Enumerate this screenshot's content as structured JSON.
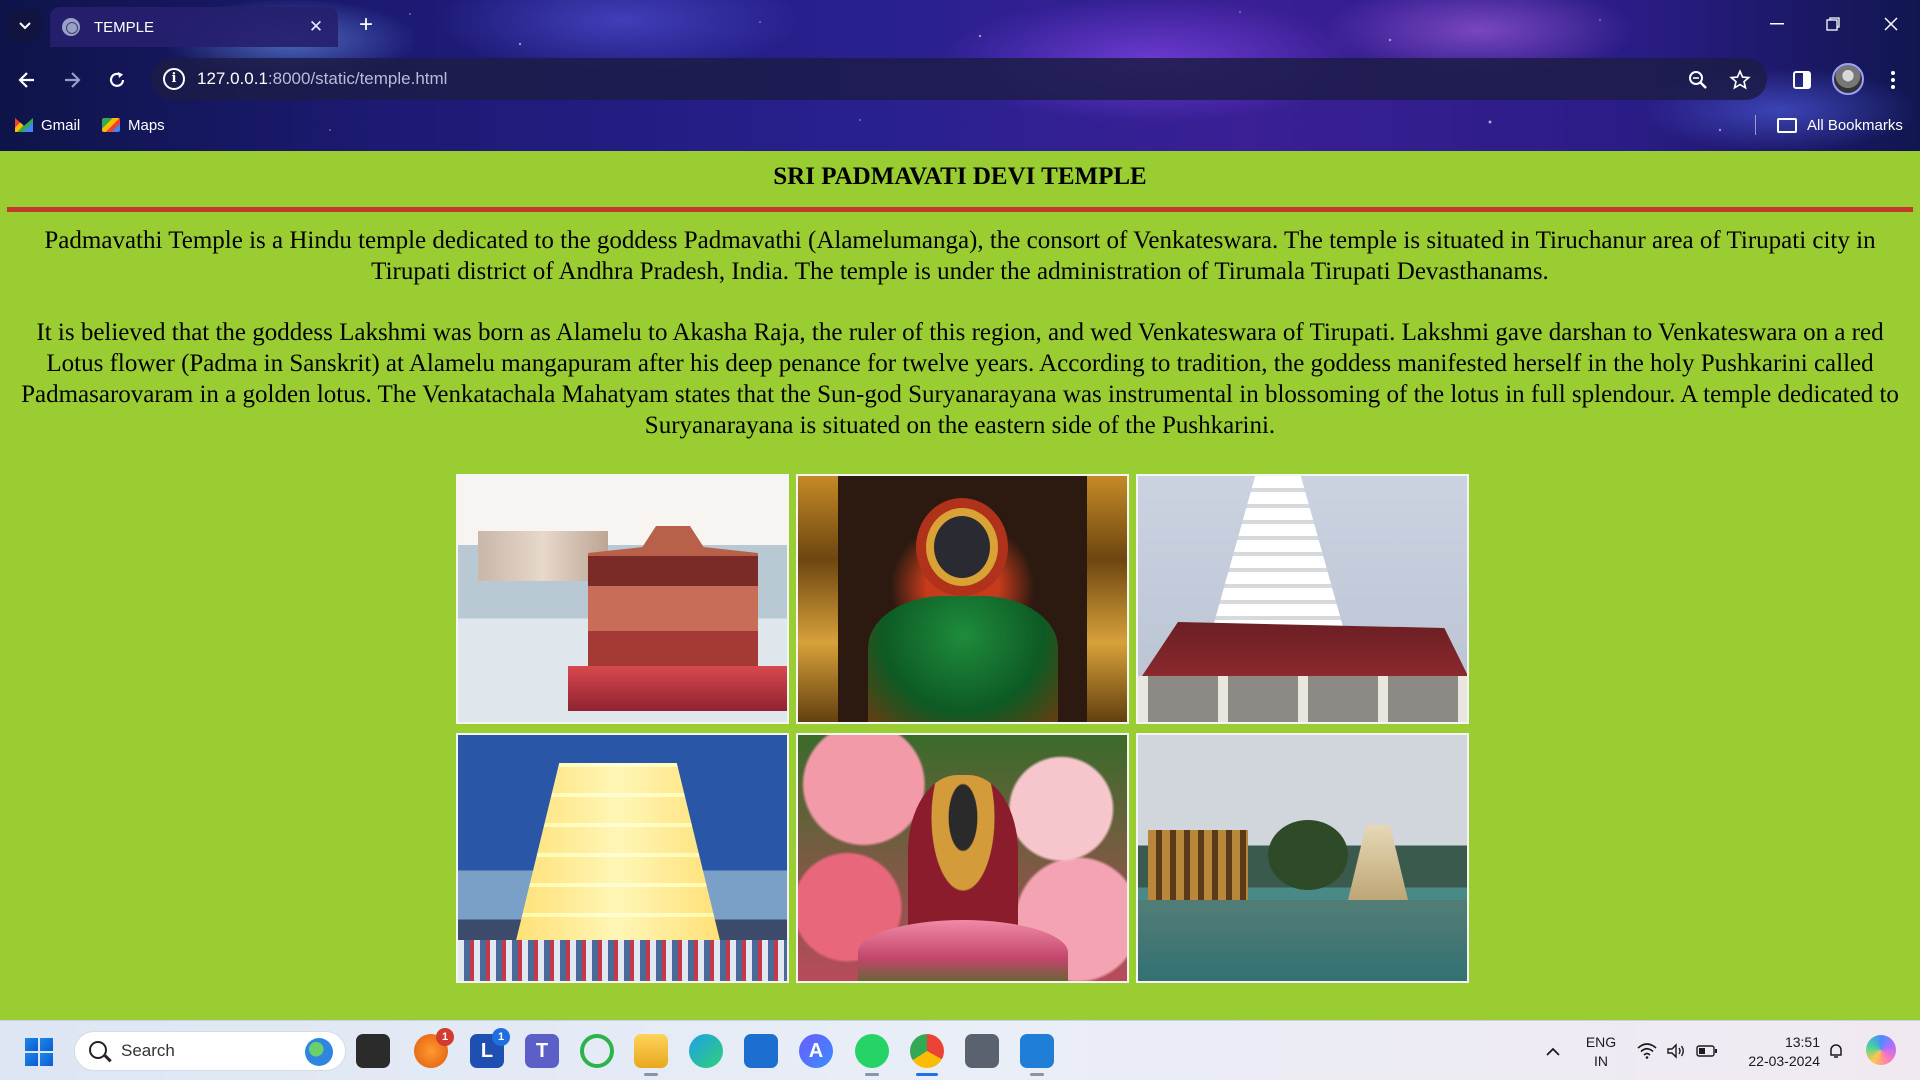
{
  "browser": {
    "tab": {
      "title": "TEMPLE"
    },
    "address": {
      "host": "127.0.0.1",
      "path": ":8000/static/temple.html"
    },
    "bookmarks": [
      {
        "label": "Gmail"
      },
      {
        "label": "Maps"
      }
    ],
    "all_bookmarks_label": "All Bookmarks"
  },
  "page": {
    "title": "SRI PADMAVATI DEVI TEMPLE",
    "paragraphs": [
      "Padmavathi Temple is a Hindu temple dedicated to the goddess Padmavathi (Alamelumanga), the consort of Venkateswara. The temple is situated in Tiruchanur area of Tirupati city in Tirupati district of Andhra Pradesh, India. The temple is under the administration of Tirumala Tirupati Devasthanams.",
      "It is believed that the goddess Lakshmi was born as Alamelu to Akasha Raja, the ruler of this region, and wed Venkateswara of Tirupati. Lakshmi gave darshan to Venkateswara on a red Lotus flower (Padma in Sanskrit) at Alamelu mangapuram after his deep penance for twelve years. According to tradition, the goddess manifested herself in the holy Pushkarini called Padmasarovaram in a golden lotus. The Venkatachala Mahatyam states that the Sun-god Suryanarayana was instrumental in blossoming of the lotus in full splendour. A temple dedicated to Suryanarayana is situated on the eastern side of the Pushkarini."
    ],
    "background_color": "#9acd32",
    "rule_color": "#c0392b"
  },
  "taskbar": {
    "search_placeholder": "Search",
    "badges": {
      "app1": "1",
      "app2": "1"
    },
    "language": {
      "line1": "ENG",
      "line2": "IN"
    },
    "clock": {
      "time": "13:51",
      "date": "22-03-2024"
    }
  }
}
